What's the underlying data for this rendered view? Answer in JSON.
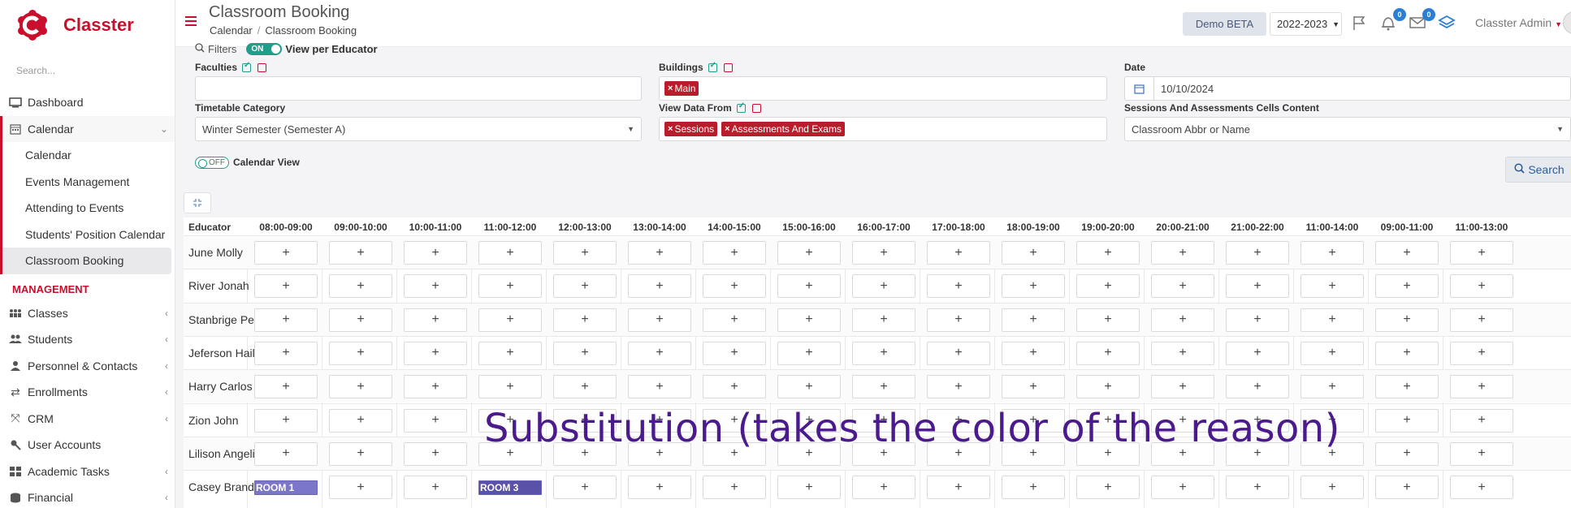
{
  "app": {
    "name": "Classter",
    "brand_color": "#c8102e"
  },
  "sidebar": {
    "search_placeholder": "Search...",
    "items": [
      {
        "label": "Dashboard",
        "icon": "monitor-icon",
        "has_children": false
      },
      {
        "label": "Calendar",
        "icon": "calendar-icon",
        "has_children": true,
        "expanded": true,
        "children": [
          {
            "label": "Calendar"
          },
          {
            "label": "Events Management"
          },
          {
            "label": "Attending to Events"
          },
          {
            "label": "Students' Position Calendar"
          },
          {
            "label": "Classroom Booking",
            "active": true
          }
        ]
      }
    ],
    "management_heading": "MANAGEMENT",
    "management_items": [
      {
        "label": "Classes",
        "icon": "classes-icon",
        "has_children": true
      },
      {
        "label": "Students",
        "icon": "students-icon",
        "has_children": true
      },
      {
        "label": "Personnel & Contacts",
        "icon": "person-icon",
        "has_children": true
      },
      {
        "label": "Enrollments",
        "icon": "swap-icon",
        "has_children": true
      },
      {
        "label": "CRM",
        "icon": "crm-icon",
        "has_children": true
      },
      {
        "label": "User Accounts",
        "icon": "key-icon",
        "has_children": false
      },
      {
        "label": "Academic Tasks",
        "icon": "grid-icon",
        "has_children": true
      },
      {
        "label": "Financial",
        "icon": "coins-icon",
        "has_children": true
      }
    ]
  },
  "header": {
    "title": "Classroom Booking",
    "breadcrumb": [
      "Calendar",
      "Classroom Booking"
    ],
    "demo_label": "Demo BETA",
    "year_value": "2022-2023",
    "notifications_count": "0",
    "messages_count": "0",
    "user_name": "Classter Admin"
  },
  "filters": {
    "filters_label": "Filters",
    "toggle_on_label": "ON",
    "view_per_educator_label": "View per Educator",
    "faculties_label": "Faculties",
    "buildings_label": "Buildings",
    "buildings_tags": [
      "Main"
    ],
    "date_label": "Date",
    "date_value": "10/10/2024",
    "timetable_category_label": "Timetable Category",
    "timetable_category_value": "Winter Semester (Semester A)",
    "view_data_from_label": "View Data From",
    "view_data_from_tags": [
      "Sessions",
      "Assessments And Exams"
    ],
    "cells_content_label": "Sessions And Assessments Cells Content",
    "cells_content_value": "Classroom Abbr or Name",
    "toggle_off_label": "OFF",
    "calendar_view_label": "Calendar View",
    "search_label": "Search"
  },
  "grid": {
    "educator_header": "Educator",
    "columns": [
      "08:00-09:00",
      "09:00-10:00",
      "10:00-11:00",
      "11:00-12:00",
      "12:00-13:00",
      "13:00-14:00",
      "14:00-15:00",
      "15:00-16:00",
      "16:00-17:00",
      "17:00-18:00",
      "18:00-19:00",
      "19:00-20:00",
      "20:00-21:00",
      "21:00-22:00",
      "11:00-14:00",
      "09:00-11:00",
      "11:00-13:00"
    ],
    "add_symbol": "+",
    "rows": [
      {
        "name": "June Molly",
        "bookings": {}
      },
      {
        "name": "River Jonah",
        "bookings": {}
      },
      {
        "name": "Stanbrige Peter",
        "bookings": {}
      },
      {
        "name": "Jeferson Hailey",
        "bookings": {}
      },
      {
        "name": "Harry Carlos",
        "bookings": {}
      },
      {
        "name": "Zion John",
        "bookings": {}
      },
      {
        "name": "Lilison Angelina",
        "bookings": {}
      },
      {
        "name": "Casey Brandy",
        "bookings": {
          "0": "ROOM 1",
          "3": "ROOM 3"
        }
      }
    ]
  },
  "overlay_caption": "Substitution (takes the color of the reason)"
}
